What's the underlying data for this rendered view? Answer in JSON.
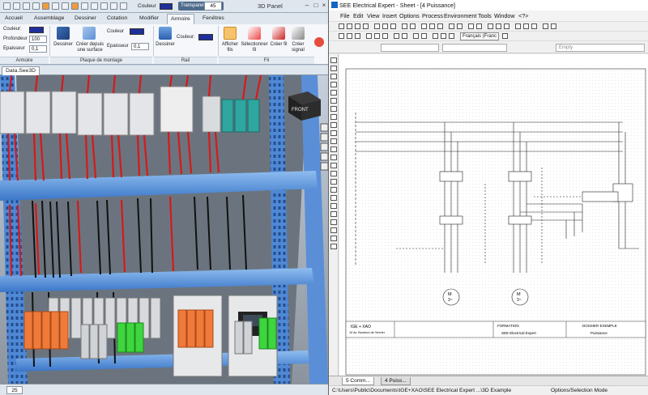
{
  "left_window": {
    "title": "3D Panel",
    "quick_access": {
      "color_label": "Couleur",
      "transparency_label": "Transparence",
      "transparency_value": "45",
      "color_value": "#1f2f9a"
    },
    "tabs": [
      "Accueil",
      "Assemblage",
      "Dessiner",
      "Cotation",
      "Modifier",
      "Armoire",
      "Fenêtres"
    ],
    "active_tab": "Armoire",
    "ribbon": {
      "armoire_group": {
        "label": "Armoire",
        "color_label": "Couleur:",
        "depth_label": "Profondeur",
        "depth_value": "100",
        "thickness_label": "Epaisseur",
        "thickness_value": "0,1"
      },
      "plaque_group": {
        "label": "Plaque de montage",
        "draw_label": "Dessiner",
        "create_from_surface_label": "Créer depuis une surface",
        "color_label": "Couleur",
        "thickness_label": "Epaisseur",
        "thickness_value": "0,1"
      },
      "rail_group": {
        "label": "Rail",
        "draw_label": "Dessiner",
        "color_label": "Couleur:"
      },
      "fil_group": {
        "label": "Fil",
        "show_wires_label": "Afficher fils",
        "select_wire_label": "Sélectionner fil",
        "create_wire_label": "Créer fil",
        "create_signal_label": "Créer signal"
      }
    },
    "doc_tab": "Data.See3D",
    "view_cube_label": "FRONT",
    "zoom_value": "25"
  },
  "right_window": {
    "title": "SEE Electrical Expert - Sheet - [4 Puissance]",
    "menu": [
      "File",
      "Edit",
      "View",
      "Insert",
      "Options",
      "Process",
      "Environment",
      "Tools",
      "Window",
      "<?>"
    ],
    "language": "Français (Franc",
    "style_field": "Empty",
    "sheet_tabs": [
      "5 Comm...",
      "4 Puiss..."
    ],
    "status_path": "C:\\Users\\Public\\Documents\\IGE+XAO\\SEE Electrical Expert ...\\3D Example",
    "status_mode": "Options/Selection Mode",
    "cartouche": {
      "company": "IGE + XAO",
      "address": "10 Av. Bourbon de Sevrier",
      "formation": "FORMATION",
      "product": "SEE Electrical Expert",
      "dossier": "DOSSIER EXEMPLE",
      "folio": "Puissance"
    },
    "motor_labels": [
      "M",
      "3~",
      "M",
      "3~",
      "M",
      "3~"
    ]
  },
  "colors": {
    "ribbon_bg": "#f5f7fa",
    "cabinet_blue": "#5b8fd6",
    "wire_red": "#d41a1a",
    "terminal_orange": "#f07a3a",
    "terminal_green": "#3ed53e"
  }
}
